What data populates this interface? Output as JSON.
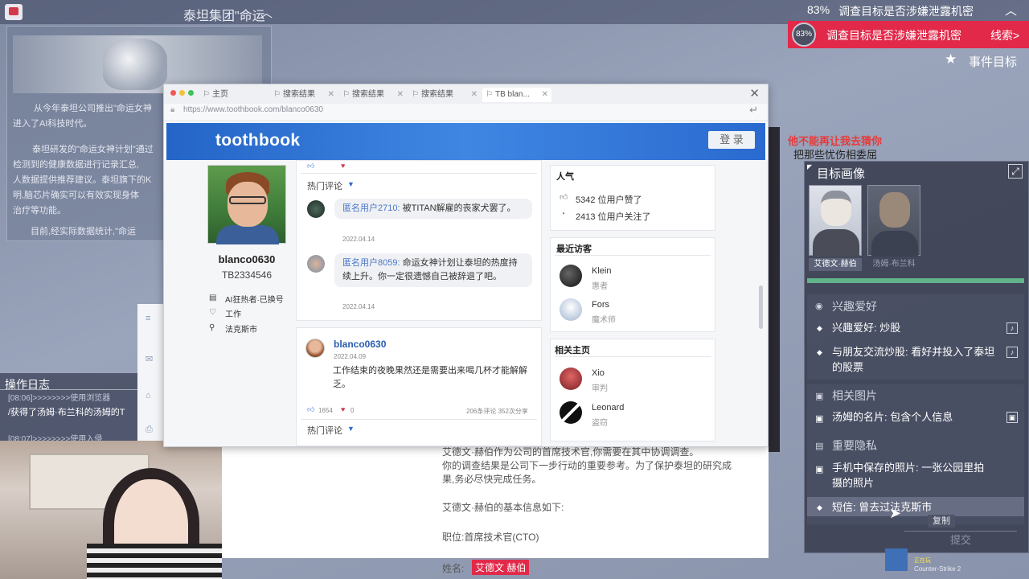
{
  "game": {
    "doc_title": "泰坦集团\"命运",
    "top_progress": "83%",
    "top_objective": "调查目标是否涉嫌泄露机密",
    "objective_badge": "83%",
    "objective_text": "调查目标是否涉嫌泄露机密",
    "objective_clue": "线索>",
    "event_label": "事件目标",
    "hint_red": "他不能再让我去猜你",
    "hint_dark": "把那些忧伤相委屈",
    "doc_paragraphs": [
      "从今年泰坦公司推出\"命运女神",
      "进入了AI科技时代。",
      "泰坦研发的\"命运女神计划\"通过",
      "检测到的健康数据进行记录汇总,",
      "人数据提供推荐建议。泰坦旗下的K",
      "明,脑芯片确实可以有效实现身体",
      "治疗等功能。",
      "目前,经实际数据统计,\"命运"
    ],
    "log": {
      "title": "操作日志",
      "line1": "[08:06]>>>>>>>>使用浏览器",
      "line2": "/获得了汤姆·布兰科的汤姆的T",
      "line3": "[08:07]>>>>>>>>使用入侵"
    },
    "lower_doc": {
      "line1": "艾德文·赫伯作为公司的首席技术官,你需要在其中协调调查。",
      "line2": "你的调查结果是公司下一步行动的重要参考。为了保护泰坦的研究成",
      "line3": "果,务必尽快完成任务。",
      "line4": "艾德文·赫伯的基本信息如下:",
      "line5": "职位:首席技术官(CTO)",
      "name_label": "姓名:",
      "name_value": "艾德文 赫伯"
    }
  },
  "target_panel": {
    "title": "目标画像",
    "portraits": [
      {
        "label": "艾德文·赫伯"
      },
      {
        "label": "汤姆·布兰科"
      }
    ],
    "progress": 1.0,
    "sections": [
      {
        "heading": "兴趣爱好",
        "items": [
          {
            "text": "兴趣爱好: 炒股"
          },
          {
            "text": "与朋友交流炒股: 看好并投入了泰坦的股票"
          }
        ]
      },
      {
        "heading": "相关图片",
        "items": [
          {
            "text": "汤姆的名片: 包含个人信息"
          }
        ]
      },
      {
        "heading": "重要隐私",
        "items": [
          {
            "text": "手机中保存的照片: 一张公园里拍摄的照片"
          },
          {
            "text": "短信: 曾去过法克斯市"
          }
        ]
      }
    ],
    "tooltip": "复制",
    "submit": "提交"
  },
  "tray": {
    "status": "正在玩",
    "game": "Counter-Strike 2"
  },
  "browser": {
    "tabs": [
      {
        "label": "主页"
      },
      {
        "label": "搜索结果"
      },
      {
        "label": "搜索结果"
      },
      {
        "label": "搜索结果"
      },
      {
        "label": "TB blan..."
      }
    ],
    "url": "https://www.toothbook.com/blanco0630",
    "site": {
      "logo": "toothbook",
      "login": "登 录"
    },
    "profile": {
      "username": "blanco0630",
      "id": "TB2334546",
      "meta": [
        {
          "icon": "id-card-icon",
          "text": "AI狂热者·已换号"
        },
        {
          "icon": "heart-icon",
          "text": "工作"
        },
        {
          "icon": "location-icon",
          "text": "法克斯市"
        }
      ]
    },
    "feed": {
      "hot_label": "热门评论",
      "comments": [
        {
          "user": "匿名用户2710:",
          "text": "被TITAN解雇的丧家犬罢了。",
          "date": "2022.04.14"
        },
        {
          "user": "匿名用户8059:",
          "text": "命运女神计划让泰坦的热度持续上升。你一定很遗憾自己被辞退了吧。",
          "date": "2022.04.14"
        }
      ],
      "post": {
        "user": "blanco0630",
        "date": "2022.04.09",
        "text": "工作结束的夜晚果然还是需要出来喝几杯才能解解乏。",
        "likes": "1654",
        "hearts": "0",
        "stats": "206条评论 352次分享"
      },
      "hot_label_2": "热门评论"
    },
    "popularity": {
      "title": "人气",
      "likes": "5342 位用户赞了",
      "follows": "2413 位用户关注了"
    },
    "visitors": {
      "title": "最近访客",
      "items": [
        {
          "name": "Klein",
          "sub": "惠者"
        },
        {
          "name": "Fors",
          "sub": "魔术师"
        }
      ]
    },
    "related": {
      "title": "相关主页",
      "items": [
        {
          "name": "Xio",
          "sub": "审判"
        },
        {
          "name": "Leonard",
          "sub": "盗窃"
        }
      ]
    }
  }
}
